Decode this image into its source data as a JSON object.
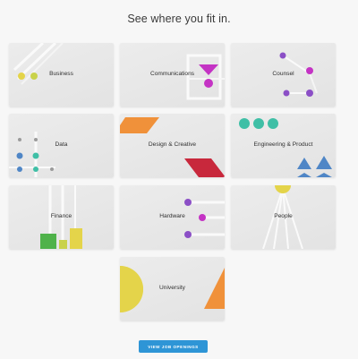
{
  "heading": "See where you fit in.",
  "categories": [
    {
      "label": "Business"
    },
    {
      "label": "Communications"
    },
    {
      "label": "Counsel"
    },
    {
      "label": "Data"
    },
    {
      "label": "Design & Creative"
    },
    {
      "label": "Engineering & Product"
    },
    {
      "label": "Finance"
    },
    {
      "label": "Hardware"
    },
    {
      "label": "People"
    },
    {
      "label": "University"
    }
  ],
  "cta": {
    "label": "VIEW JOB OPENINGS"
  },
  "colors": {
    "yellow": "#e4d44a",
    "magenta": "#c433c4",
    "purple": "#8b4fc6",
    "teal": "#3fbfa6",
    "orange": "#f0913a",
    "red": "#c8283c",
    "blue": "#4f86c6",
    "green": "#4fb24a",
    "button": "#2e95d6"
  }
}
